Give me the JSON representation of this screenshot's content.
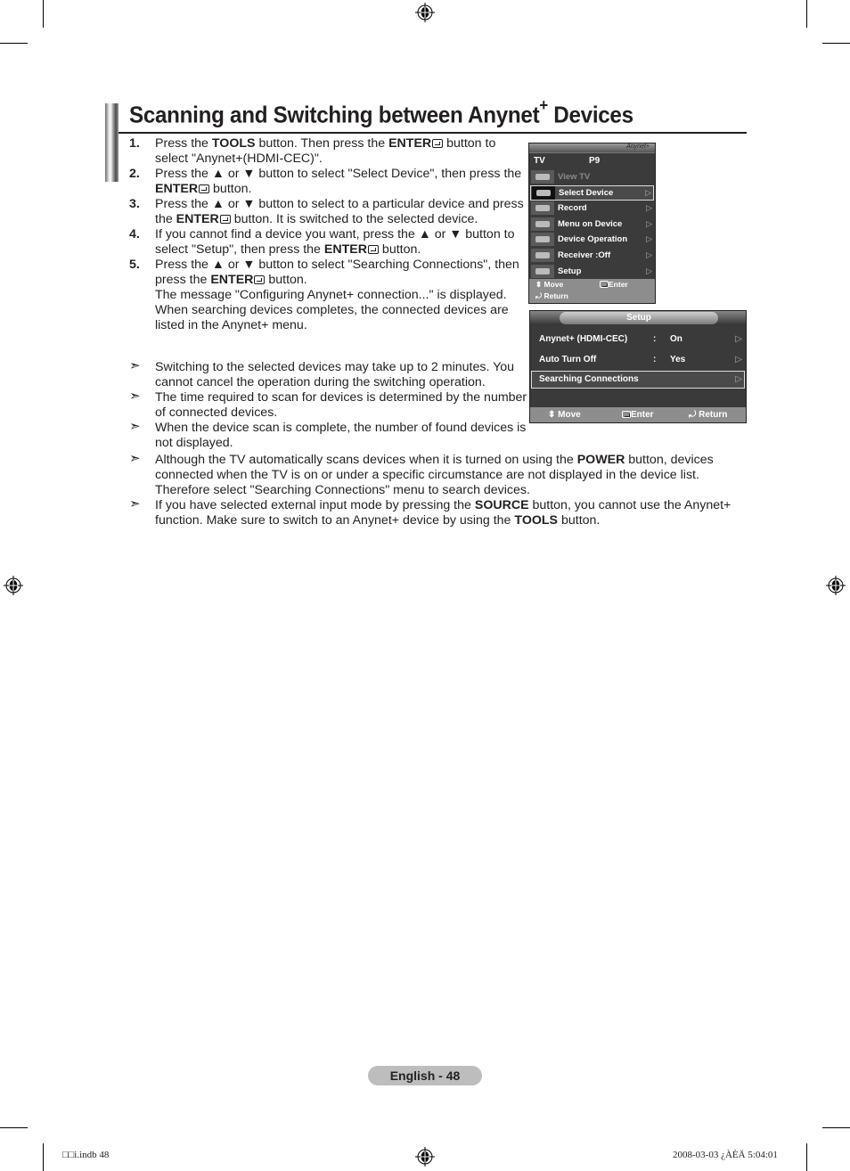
{
  "page": {
    "title": "Scanning and Switching between Anynet",
    "title_sup": "+",
    "title_suffix": " Devices"
  },
  "steps": [
    {
      "num": "1.",
      "parts": [
        "Press the ",
        {
          "b": "TOOLS"
        },
        " button. Then press the ",
        {
          "b": "ENTER"
        },
        {
          "icon": "enter"
        },
        " button to select \"Anynet+(HDMI-CEC)\"."
      ]
    },
    {
      "num": "2.",
      "parts": [
        "Press the ▲ or ▼ button to select \"Select Device\", then press the ",
        {
          "b": "ENTER"
        },
        {
          "icon": "enter"
        },
        " button."
      ]
    },
    {
      "num": "3.",
      "parts": [
        "Press the ▲ or ▼ button to select to a particular device and press the ",
        {
          "b": "ENTER"
        },
        {
          "icon": "enter"
        },
        " button. It is switched to the selected device."
      ]
    },
    {
      "num": "4.",
      "parts": [
        "If you cannot find a device you want, press the ▲ or ▼ button to select \"Setup\", then press the ",
        {
          "b": "ENTER"
        },
        {
          "icon": "enter"
        },
        " button."
      ]
    },
    {
      "num": "5.",
      "parts": [
        "Press the ▲ or ▼ button to select \"Searching Connections\", then press the ",
        {
          "b": "ENTER"
        },
        {
          "icon": "enter"
        },
        " button.",
        {
          "br": true
        },
        "The message \"Configuring Anynet+ connection...\" is displayed. When searching devices completes, the connected devices are listed in the Anynet+ menu."
      ]
    }
  ],
  "notes_narrow": [
    {
      "parts": [
        "Switching to the selected devices may take up to 2 minutes. You cannot cancel the operation during the switching operation."
      ]
    },
    {
      "parts": [
        "The time required to scan for devices is determined by the number of connected devices."
      ]
    },
    {
      "parts": [
        "When the device scan is complete, the number of found devices is not displayed."
      ]
    }
  ],
  "notes_wide": [
    {
      "parts": [
        "Although the TV automatically scans devices when it is turned on using the ",
        {
          "b": "POWER"
        },
        " button, devices connected when the TV is on or under a specific circumstance are not displayed in the device list. Therefore select \"Searching Connections\" menu to search devices."
      ]
    },
    {
      "parts": [
        "If you have selected external input mode by pressing the ",
        {
          "b": "SOURCE"
        },
        " button, you cannot use the Anynet+ function. Make sure to switch to an Anynet+ device by using the ",
        {
          "b": "TOOLS"
        },
        " button."
      ]
    }
  ],
  "note_arrow": "➣",
  "osd_anynet": {
    "logo": "Anynet+",
    "source": "TV",
    "channel": "P9",
    "items": [
      {
        "label": "View TV",
        "icon": "tv-icon",
        "state": "disabled"
      },
      {
        "label": "Select Device",
        "icon": "select-device-icon",
        "state": "selected",
        "arrow": "▷"
      },
      {
        "label": "Record",
        "icon": "record-icon",
        "arrow": "▷"
      },
      {
        "label": "Menu on Device",
        "icon": "menu-device-icon",
        "arrow": "▷"
      },
      {
        "label": "Device Operation",
        "icon": "device-operation-icon",
        "arrow": "▷"
      },
      {
        "label": "Receiver      :Off",
        "icon": "receiver-icon",
        "arrow": "▷"
      },
      {
        "label": "Setup",
        "icon": "setup-gear-icon",
        "arrow": "▷"
      }
    ],
    "footer": {
      "move": "Move",
      "enter": "Enter",
      "return": "Return"
    }
  },
  "osd_setup": {
    "title": "Setup",
    "rows": [
      {
        "label": "Anynet+ (HDMI-CEC)",
        "colon": ":",
        "value": "On",
        "arrow": "▷"
      },
      {
        "label": "Auto Turn Off",
        "colon": ":",
        "value": "Yes",
        "arrow": "▷"
      },
      {
        "label": "Searching Connections",
        "colon": "",
        "value": "",
        "arrow": "▷",
        "selected": true
      }
    ],
    "footer": {
      "move": "Move",
      "enter": "Enter",
      "return": "Return"
    }
  },
  "footer": {
    "page_label": "English - 48",
    "slug_left": "□□i.indb   48",
    "slug_right": "2008-03-03   ¿ÀÈÄ 5:04:01"
  }
}
